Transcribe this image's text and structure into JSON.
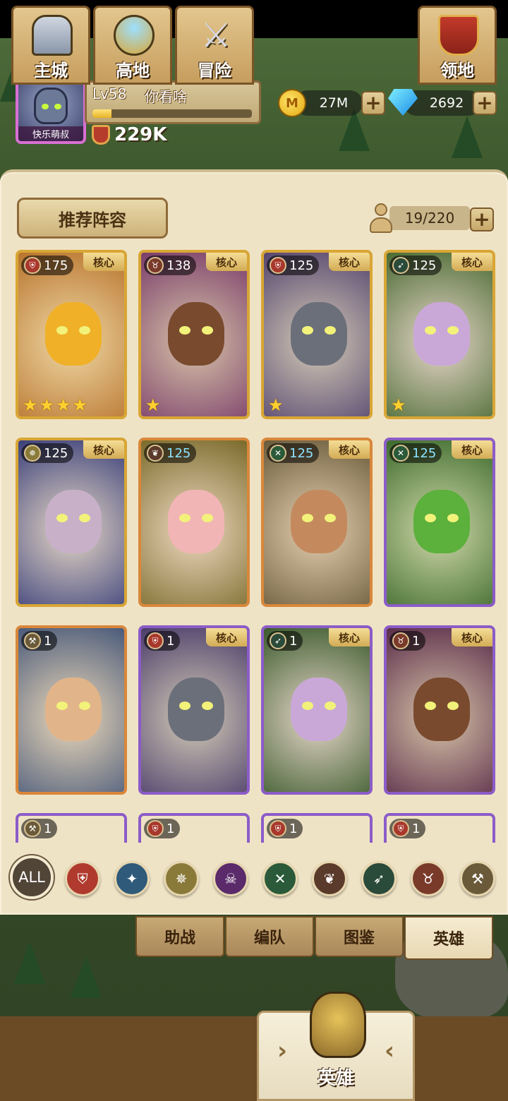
{
  "player": {
    "avatar_name": "快乐萌叔",
    "level_label": "Lv58",
    "name": "你看啥",
    "xp_fraction": 0.12,
    "power": "229K"
  },
  "resources": {
    "gold": "27M",
    "gems": "2692",
    "gold_icon_letter": "M"
  },
  "panel": {
    "recommend_label": "推荐阵容",
    "hero_count": "19/220"
  },
  "heroes": [
    {
      "level": "175",
      "class_icon": "shield-icon",
      "core": "核心",
      "stars": 4,
      "frame": "gold",
      "bg": "#b8732c",
      "face": "#f0b028"
    },
    {
      "level": "138",
      "class_icon": "bull-icon",
      "core": "核心",
      "stars": 1,
      "frame": "gold",
      "bg": "#7a3c6a",
      "face": "#7a4a2e"
    },
    {
      "level": "125",
      "class_icon": "shield-icon",
      "core": "核心",
      "stars": 1,
      "frame": "gold",
      "bg": "#55446e",
      "face": "#6b6f7a"
    },
    {
      "level": "125",
      "class_icon": "bow-icon",
      "core": "核心",
      "stars": 1,
      "frame": "gold",
      "bg": "#4a6a32",
      "face": "#c9a8d8"
    },
    {
      "level": "125",
      "class_icon": "staff-icon",
      "core": "核心",
      "stars": 0,
      "frame": "gold",
      "bg": "#3a3f7a",
      "face": "#c8b0c8"
    },
    {
      "level": "125",
      "class_icon": "paw-icon",
      "core": "",
      "stars": 0,
      "frame": "orange",
      "bg": "#7a6a2a",
      "face": "#f2b5b5",
      "blue": true
    },
    {
      "level": "125",
      "class_icon": "dagger-icon",
      "core": "核心",
      "stars": 0,
      "frame": "orange",
      "bg": "#6a5a3a",
      "face": "#c48a5e",
      "blue": true
    },
    {
      "level": "125",
      "class_icon": "dagger-icon",
      "core": "核心",
      "stars": 0,
      "frame": "purple",
      "bg": "#3c6a2c",
      "face": "#5cb03c",
      "blue": true
    },
    {
      "level": "1",
      "class_icon": "axe-icon",
      "core": "",
      "stars": 0,
      "frame": "orange",
      "bg": "#4a5a7a",
      "face": "#e2b48a"
    },
    {
      "level": "1",
      "class_icon": "shield-icon",
      "core": "核心",
      "stars": 0,
      "frame": "purple",
      "bg": "#4a3c6a",
      "face": "#6b6f7a"
    },
    {
      "level": "1",
      "class_icon": "bow-icon",
      "core": "核心",
      "stars": 0,
      "frame": "purple",
      "bg": "#3a5a2c",
      "face": "#c9a8d8"
    },
    {
      "level": "1",
      "class_icon": "bull-icon",
      "core": "核心",
      "stars": 0,
      "frame": "purple",
      "bg": "#5a2c4a",
      "face": "#7a4a2e"
    },
    {
      "level": "1",
      "class_icon": "axe-icon",
      "core": "",
      "stars": 0,
      "frame": "purple",
      "bg": "#3a5a6a",
      "face": "#888"
    },
    {
      "level": "1",
      "class_icon": "shield-icon",
      "core": "",
      "stars": 0,
      "frame": "purple",
      "bg": "#6a4a3a",
      "face": "#888"
    },
    {
      "level": "1",
      "class_icon": "shield-icon",
      "core": "",
      "stars": 0,
      "frame": "purple",
      "bg": "#6a4a3a",
      "face": "#888"
    },
    {
      "level": "1",
      "class_icon": "shield-icon",
      "core": "",
      "stars": 0,
      "frame": "purple",
      "bg": "#6a4a3a",
      "face": "#888"
    }
  ],
  "filters": {
    "all_label": "ALL",
    "items": [
      {
        "icon": "shield-icon",
        "color": "#b13a2e",
        "glyph": "⛨"
      },
      {
        "icon": "mage-icon",
        "color": "#2f5a7a",
        "glyph": "✦"
      },
      {
        "icon": "holy-icon",
        "color": "#8a7a3a",
        "glyph": "✵"
      },
      {
        "icon": "skull-icon",
        "color": "#5a2a6a",
        "glyph": "☠"
      },
      {
        "icon": "dagger-icon",
        "color": "#2a5a3a",
        "glyph": "✕"
      },
      {
        "icon": "paw-icon",
        "color": "#5a3a2a",
        "glyph": "❦"
      },
      {
        "icon": "bow-icon",
        "color": "#2a4a3a",
        "glyph": "➶"
      },
      {
        "icon": "bull-icon",
        "color": "#7a3a2a",
        "glyph": "♉"
      },
      {
        "icon": "axe-icon",
        "color": "#6a5a3a",
        "glyph": "⚒"
      }
    ]
  },
  "subtabs": [
    "助战",
    "编队",
    "图鉴",
    "英雄"
  ],
  "nav": {
    "items": [
      "主城",
      "高地",
      "冒险"
    ],
    "active": "英雄",
    "last": "领地"
  }
}
